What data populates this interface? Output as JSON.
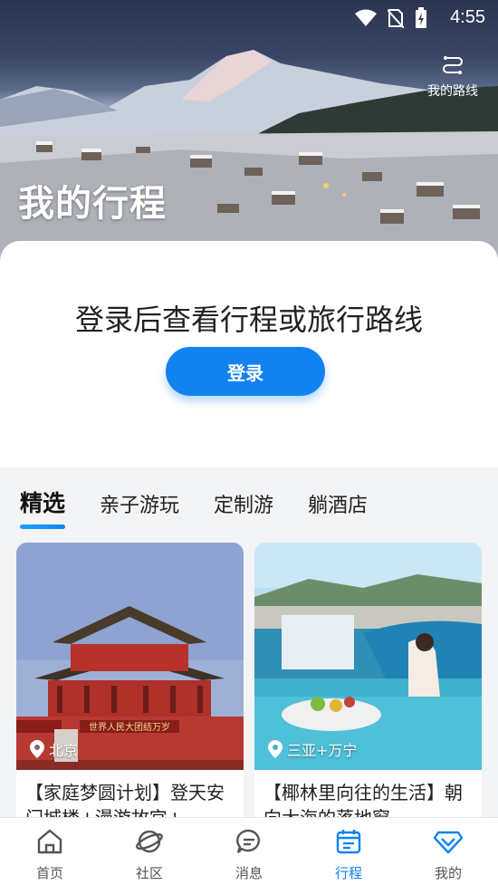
{
  "statusbar": {
    "time": "4:55",
    "icons": [
      "wifi-icon",
      "no-sim-icon",
      "battery-charging-icon"
    ]
  },
  "hero": {
    "title": "我的行程",
    "route_label": "我的路线"
  },
  "login": {
    "message": "登录后查看行程或旅行路线",
    "button_label": "登录"
  },
  "tabs": [
    {
      "label": "精选",
      "active": true
    },
    {
      "label": "亲子游玩",
      "active": false
    },
    {
      "label": "定制游",
      "active": false
    },
    {
      "label": "躺酒店",
      "active": false
    }
  ],
  "cards": [
    {
      "location": "北京",
      "title": "【家庭梦圆计划】登天安门城楼+漫游故宫+",
      "gate_text": "世界人民大团结万岁"
    },
    {
      "location": "三亚+万宁",
      "title": "【椰林里向往的生活】朝向大海的落地窗"
    }
  ],
  "bottom_nav": [
    {
      "label": "首页",
      "icon": "home-icon",
      "active": false
    },
    {
      "label": "社区",
      "icon": "planet-icon",
      "active": false
    },
    {
      "label": "消息",
      "icon": "message-icon",
      "active": false
    },
    {
      "label": "行程",
      "icon": "calendar-icon",
      "active": true
    },
    {
      "label": "我的",
      "icon": "diamond-icon",
      "active": false
    }
  ],
  "colors": {
    "accent": "#1182f0"
  }
}
